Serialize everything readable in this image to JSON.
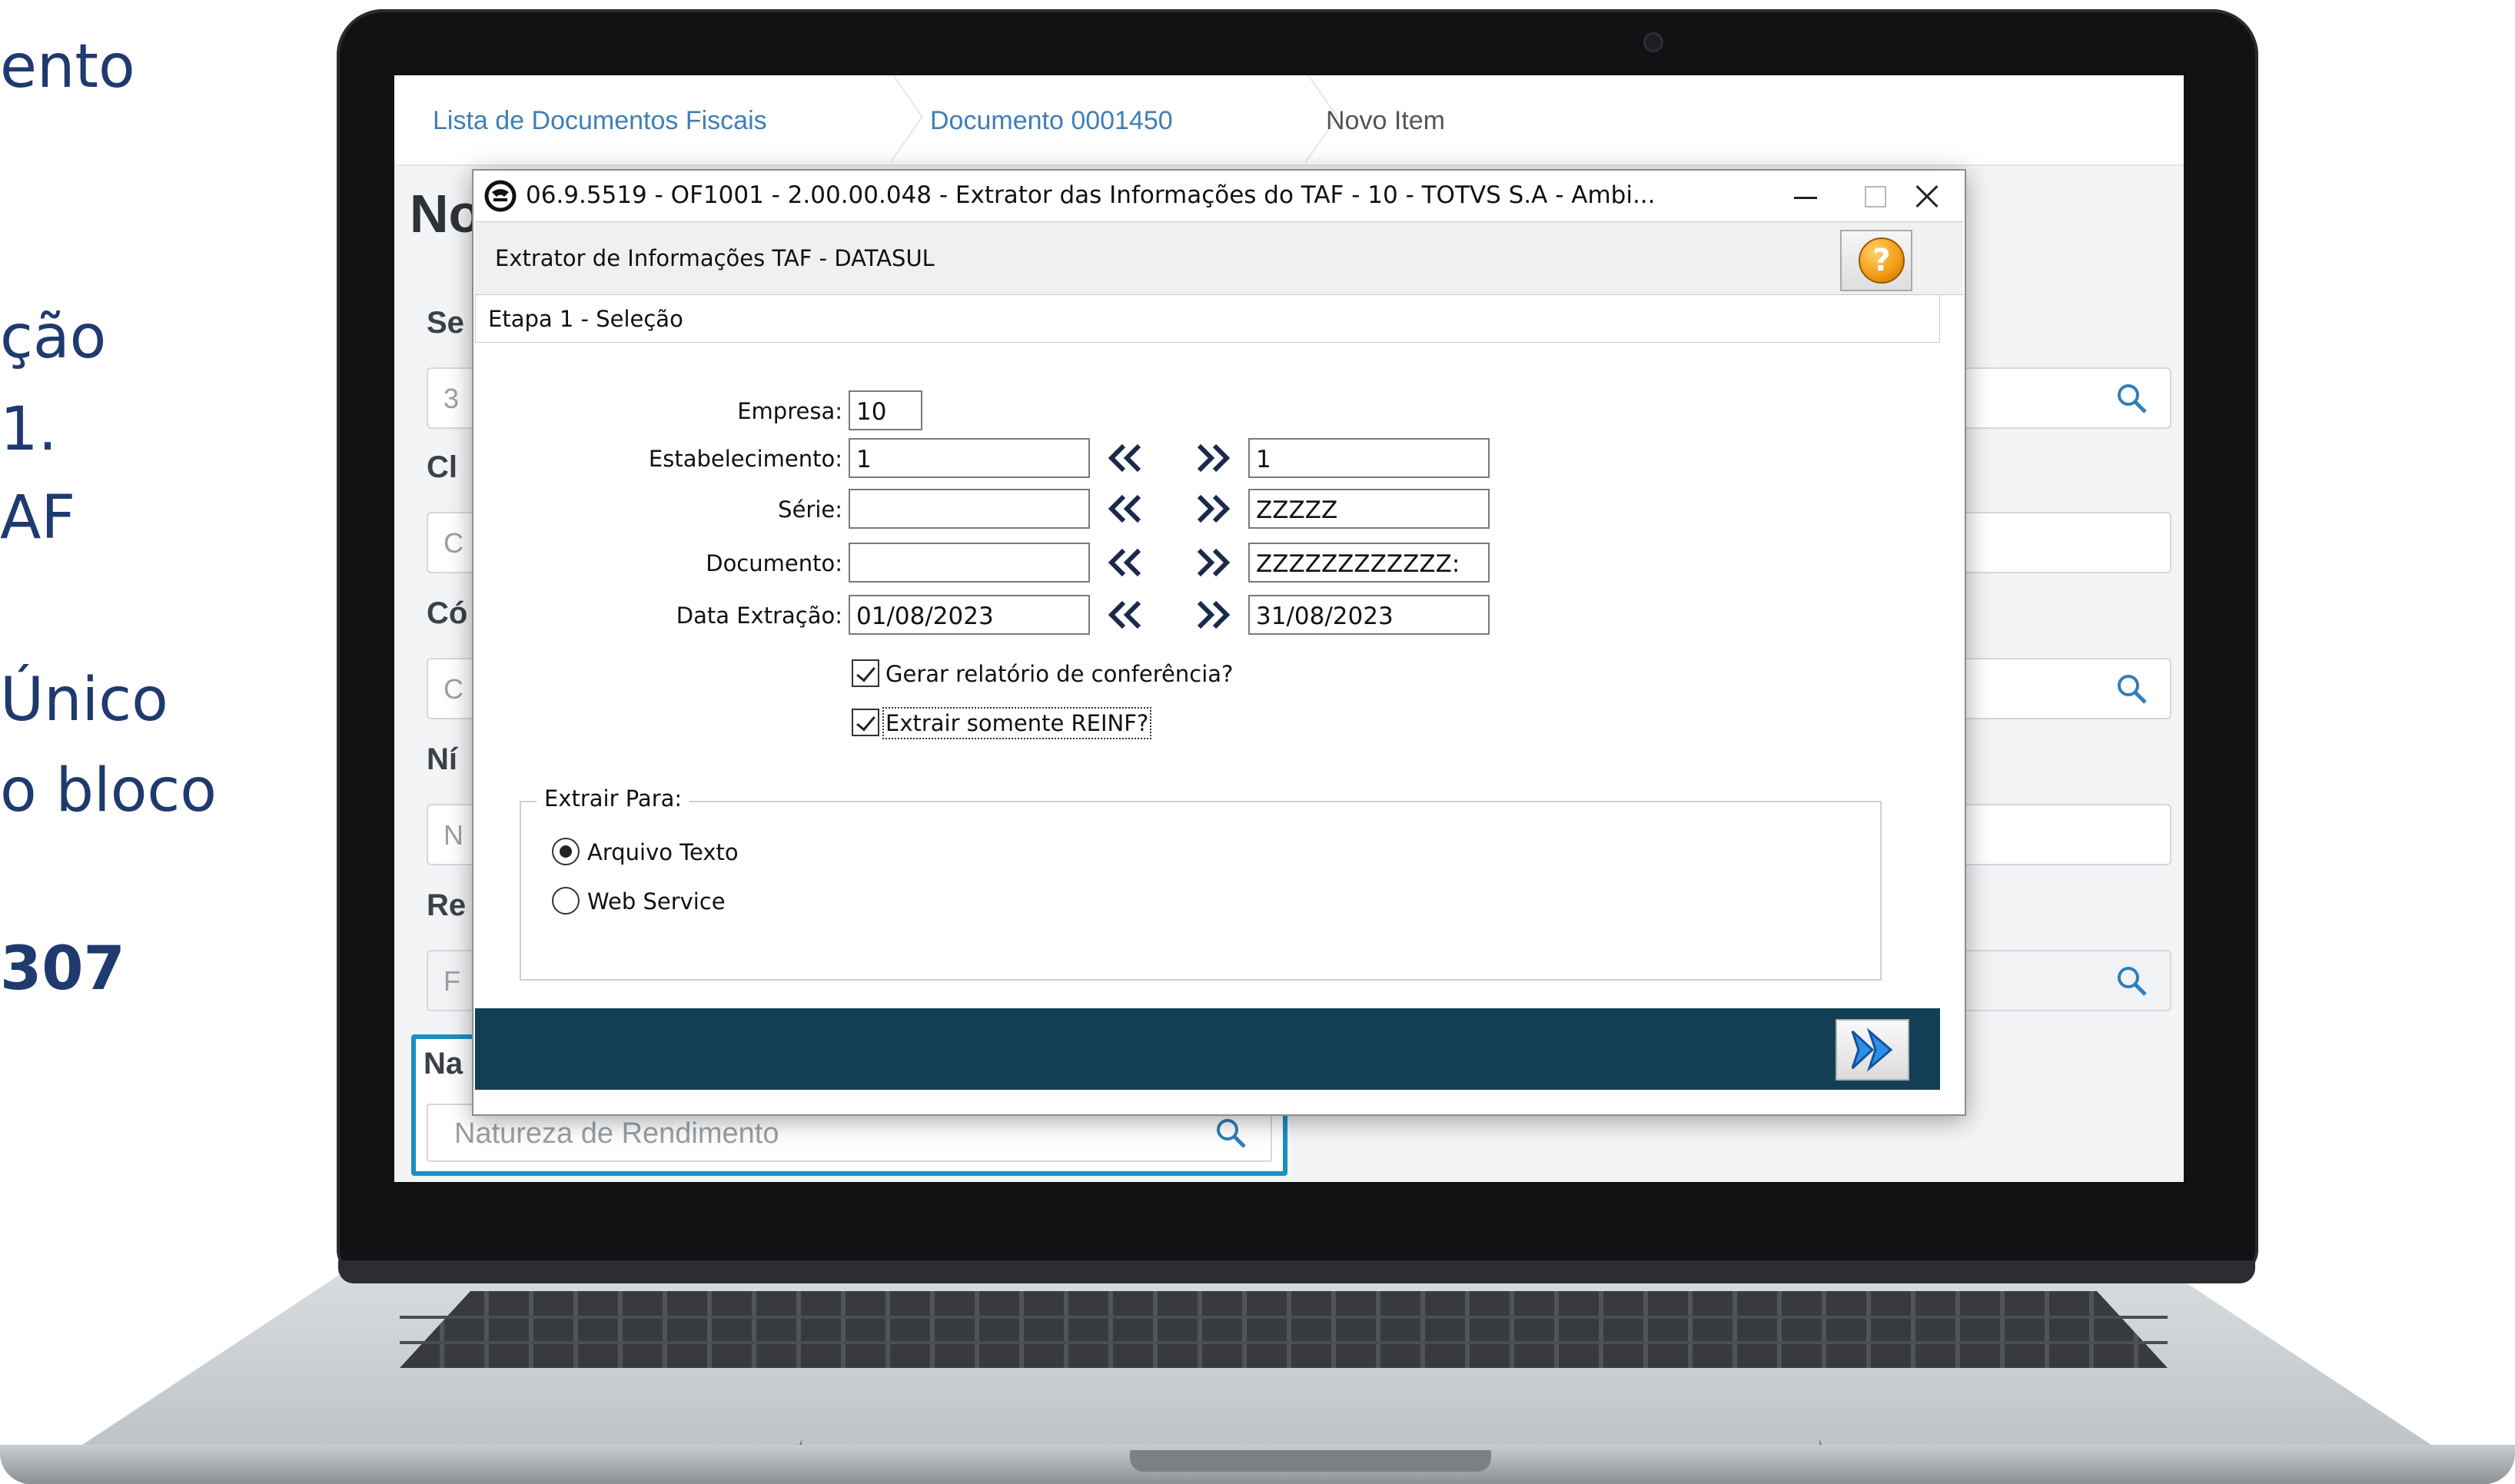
{
  "slide": {
    "fragments": [
      "ento",
      "ção",
      "1.",
      "AF",
      "Único",
      "o bloco",
      "307"
    ]
  },
  "app": {
    "breadcrumbs": [
      "Lista de Documentos Fiscais",
      "Documento 0001450",
      "Novo Item"
    ],
    "page_title": "No",
    "bg_labels": [
      "Se",
      "Cl",
      "Có",
      "Ní",
      "Re",
      "Na"
    ],
    "bg_placeholders": [
      "3",
      "C",
      "C",
      "N",
      "F"
    ],
    "natureza_placeholder": "Natureza de Rendimento"
  },
  "dialog": {
    "window_title": "06.9.5519 - OF1001 - 2.00.00.048 - Extrator das Informações do TAF - 10 - TOTVS S.A - Ambi...",
    "header": "Extrator de Informações TAF - DATASUL",
    "help_glyph": "?",
    "step": "Etapa 1 - Seleção",
    "fields": {
      "empresa": {
        "label": "Empresa:",
        "value": "10"
      },
      "estabelecimento": {
        "label": "Estabelecimento:",
        "from": "1",
        "to": "1"
      },
      "serie": {
        "label": "Série:",
        "from": "",
        "to": "ZZZZZ"
      },
      "documento": {
        "label": "Documento:",
        "from": "",
        "to": "ZZZZZZZZZZZZ:"
      },
      "data_extracao": {
        "label": "Data Extração:",
        "from": "01/08/2023",
        "to": "31/08/2023"
      }
    },
    "checkboxes": [
      {
        "label": "Gerar relatório de conferência?",
        "checked": true
      },
      {
        "label": "Extrair somente REINF?",
        "checked": true
      }
    ],
    "extrair_para": {
      "legend": "Extrair Para:",
      "options": [
        {
          "label": "Arquivo Texto",
          "selected": true
        },
        {
          "label": "Web Service",
          "selected": false
        }
      ]
    },
    "colors": {
      "footer": "#133f55",
      "accent": "#1a8fc4",
      "text_slide": "#1f3a6e"
    }
  }
}
